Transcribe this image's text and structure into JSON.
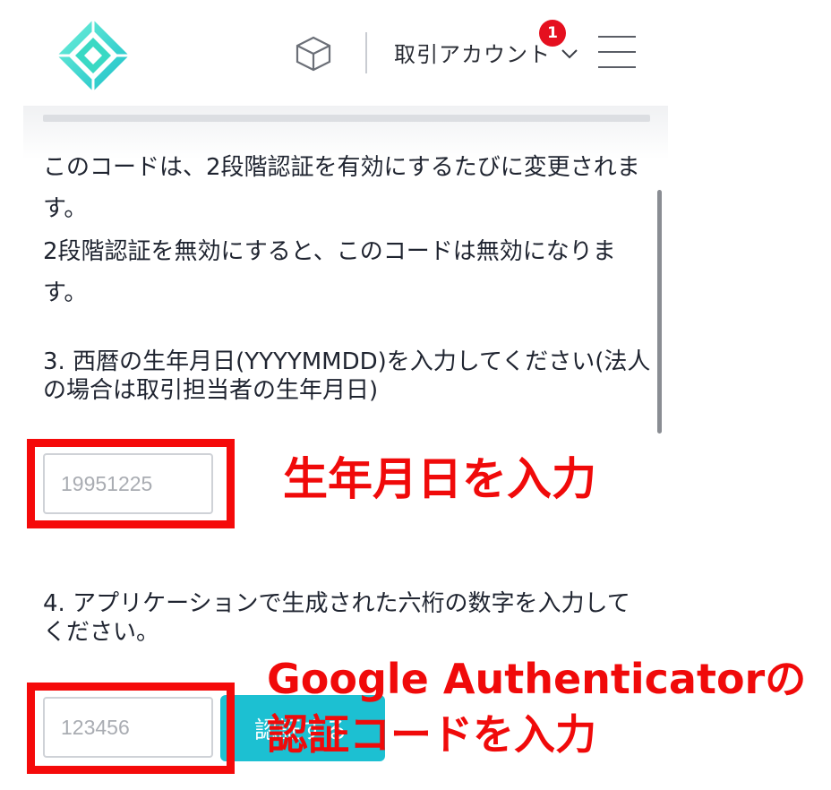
{
  "header": {
    "account_label": "取引アカウント",
    "notification_count": "1",
    "brand_color": "#3ad9c4"
  },
  "content": {
    "para1": "このコードは、2段階認証を有効にするたびに変更されます。",
    "para2": "2段階認証を無効にすると、このコードは無効になります。",
    "step3": "3. 西暦の生年月日(YYYYMMDD)を入力してください(法人の場合は取引担当者の生年月日)",
    "birthdate_placeholder": "19951225",
    "step4": "4. アプリケーションで生成された六桁の数字を入力してください。",
    "code_placeholder": "123456",
    "confirm_label": "認証する"
  },
  "annotations": {
    "birthdate_note": "生年月日を入力",
    "code_note_line1": "Google Authenticatorの",
    "code_note_line2": "認証コードを入力",
    "highlight_color": "#f50a0a"
  }
}
